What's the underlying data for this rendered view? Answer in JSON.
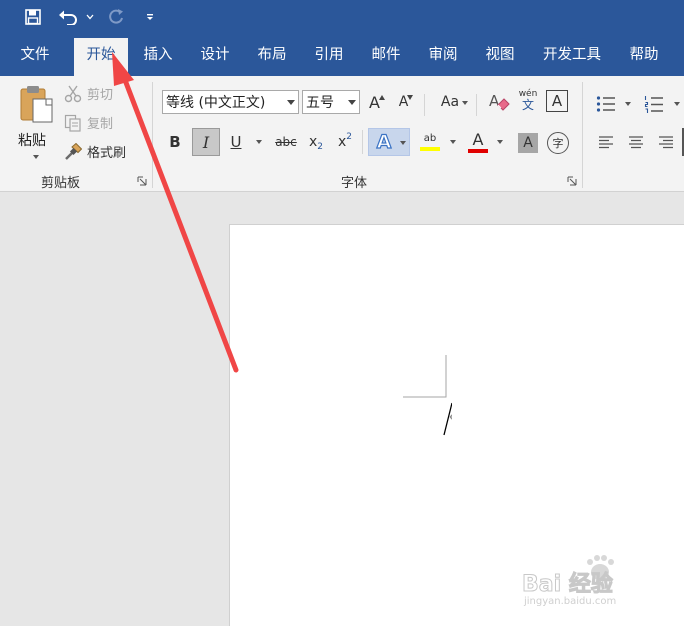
{
  "quick_access": {
    "save_icon": "save-icon",
    "undo_icon": "undo-icon",
    "redo_icon": "redo-icon",
    "customize_icon": "customize-qat-icon"
  },
  "tabs": [
    {
      "label": "文件"
    },
    {
      "label": "开始"
    },
    {
      "label": "插入"
    },
    {
      "label": "设计"
    },
    {
      "label": "布局"
    },
    {
      "label": "引用"
    },
    {
      "label": "邮件"
    },
    {
      "label": "审阅"
    },
    {
      "label": "视图"
    },
    {
      "label": "开发工具"
    },
    {
      "label": "帮助"
    }
  ],
  "active_tab": "开始",
  "clipboard": {
    "paste_label": "粘贴",
    "cut_label": "剪切",
    "copy_label": "复制",
    "format_painter_label": "格式刷",
    "group_label": "剪贴板"
  },
  "font": {
    "font_name": "等线 (中文正文)",
    "font_size": "五号",
    "group_label": "字体",
    "grow_label": "A",
    "shrink_label": "A",
    "case_label": "Aa",
    "phonetic_top": "wén",
    "phonetic_bottom": "文",
    "border_label": "A",
    "bold_label": "B",
    "italic_label": "I",
    "underline_label": "U",
    "strike_label": "abc",
    "sub_label": "x",
    "sub_mark": "2",
    "sup_label": "x",
    "sup_mark": "2",
    "effects_label": "A",
    "highlight_label": "ab",
    "font_color_label": "A",
    "shading_label": "A",
    "enclose_label": "字"
  },
  "colors": {
    "brand": "#2b579a",
    "highlight": "#ffff00",
    "font_color": "#e00000",
    "arrow": "#f04646"
  },
  "watermark": {
    "logo": "Bai 经验",
    "url": "jingyan.baidu.com"
  }
}
